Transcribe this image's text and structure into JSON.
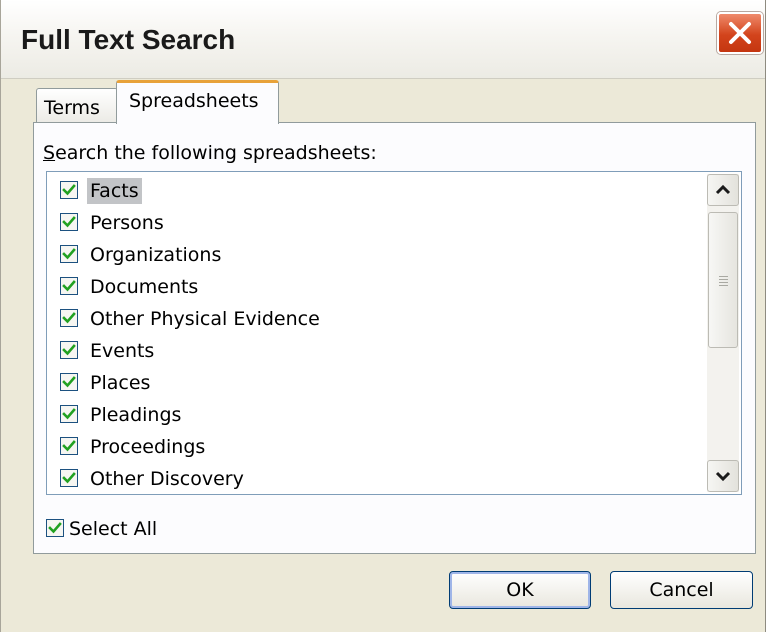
{
  "window": {
    "title": "Full Text Search"
  },
  "tabs": [
    {
      "label": "Terms",
      "active": false
    },
    {
      "label": "Spreadsheets",
      "active": true
    }
  ],
  "group_label_prefix": "S",
  "group_label_rest": "earch the following spreadsheets:",
  "spreadsheets": [
    {
      "label": "Facts",
      "checked": true,
      "selected": true
    },
    {
      "label": "Persons",
      "checked": true
    },
    {
      "label": "Organizations",
      "checked": true
    },
    {
      "label": "Documents",
      "checked": true
    },
    {
      "label": "Other Physical Evidence",
      "checked": true
    },
    {
      "label": "Events",
      "checked": true
    },
    {
      "label": "Places",
      "checked": true
    },
    {
      "label": "Pleadings",
      "checked": true
    },
    {
      "label": "Proceedings",
      "checked": true
    },
    {
      "label": "Other Discovery",
      "checked": true
    }
  ],
  "select_all": {
    "label": "Select All",
    "checked": true
  },
  "buttons": {
    "ok": "OK",
    "cancel": "Cancel"
  },
  "icons": {
    "close": "close-icon",
    "checkmark": "checkmark-icon",
    "scroll_up": "chevron-up-icon",
    "scroll_down": "chevron-down-icon"
  },
  "colors": {
    "check": "#21a121",
    "selection": "#c2c4c7",
    "tab_highlight": "#e8a23a"
  }
}
